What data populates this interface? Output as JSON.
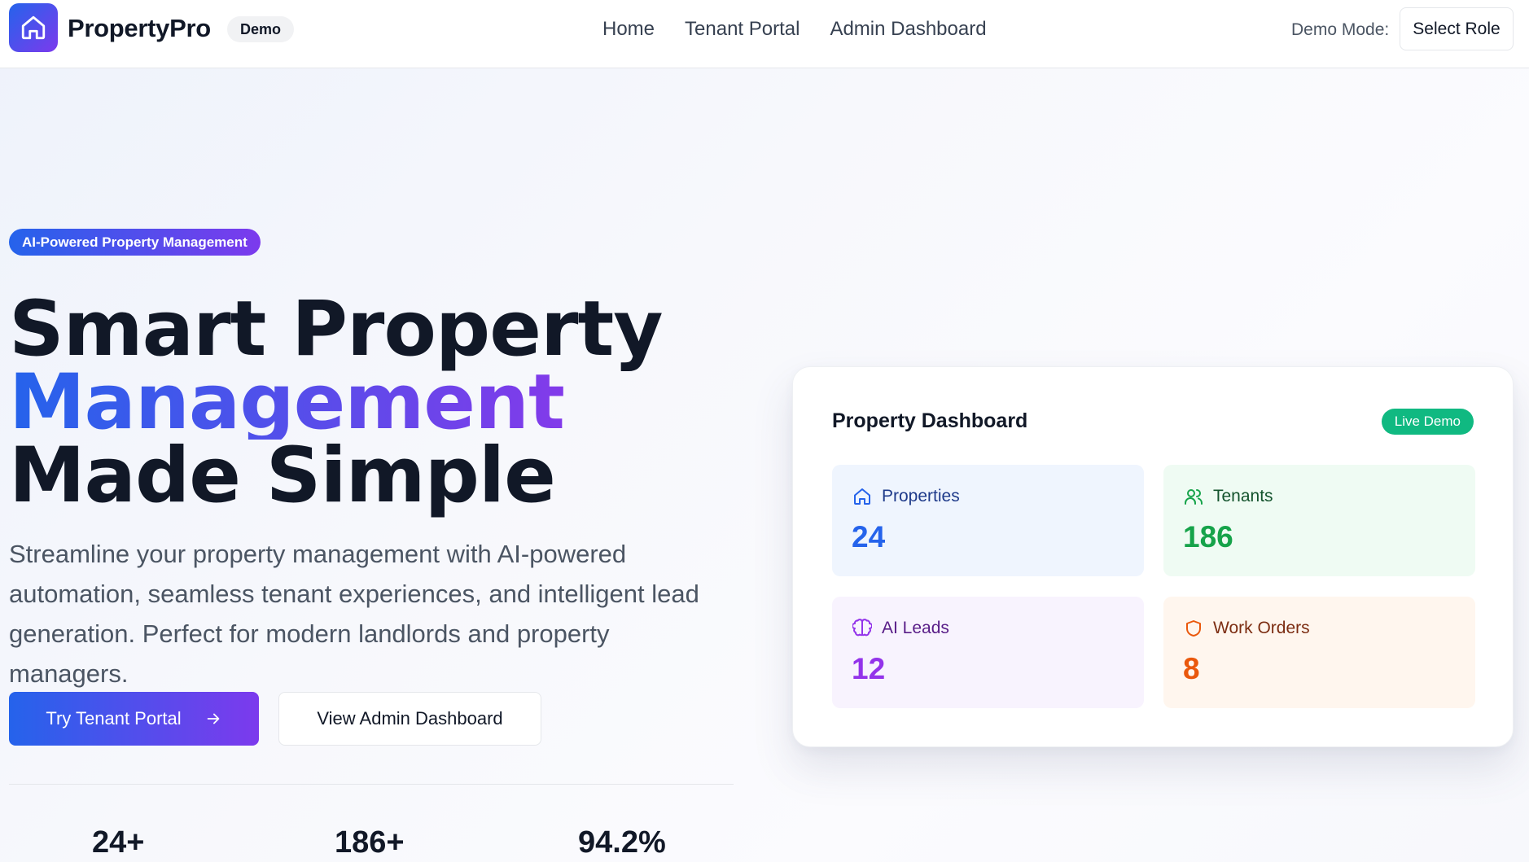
{
  "nav": {
    "brand": "PropertyPro",
    "badge": "Demo",
    "links": [
      "Home",
      "Tenant Portal",
      "Admin Dashboard"
    ],
    "demo_mode_label": "Demo Mode:",
    "role_button": "Select Role"
  },
  "hero": {
    "badge": "AI-Powered Property Management",
    "title_line1": "Smart Property",
    "title_line2": "Management",
    "title_line3": "Made Simple",
    "subtitle": "Streamline your property management with AI-powered automation, seamless tenant experiences, and intelligent lead generation. Perfect for modern landlords and property managers.",
    "primary_button": "Try Tenant Portal",
    "secondary_button": "View Admin Dashboard",
    "stats": [
      "24+",
      "186+",
      "94.2%"
    ]
  },
  "dashboard": {
    "title": "Property Dashboard",
    "badge": "Live Demo",
    "tiles": [
      {
        "label": "Properties",
        "value": "24",
        "icon": "home-icon",
        "color": "#2563eb"
      },
      {
        "label": "Tenants",
        "value": "186",
        "icon": "users-icon",
        "color": "#16a34a"
      },
      {
        "label": "AI Leads",
        "value": "12",
        "icon": "brain-icon",
        "color": "#9333ea"
      },
      {
        "label": "Work Orders",
        "value": "8",
        "icon": "shield-icon",
        "color": "#ea580c"
      }
    ]
  },
  "colors": {
    "accent_start": "#2563eb",
    "accent_end": "#7c3aed",
    "live": "#10b981"
  }
}
